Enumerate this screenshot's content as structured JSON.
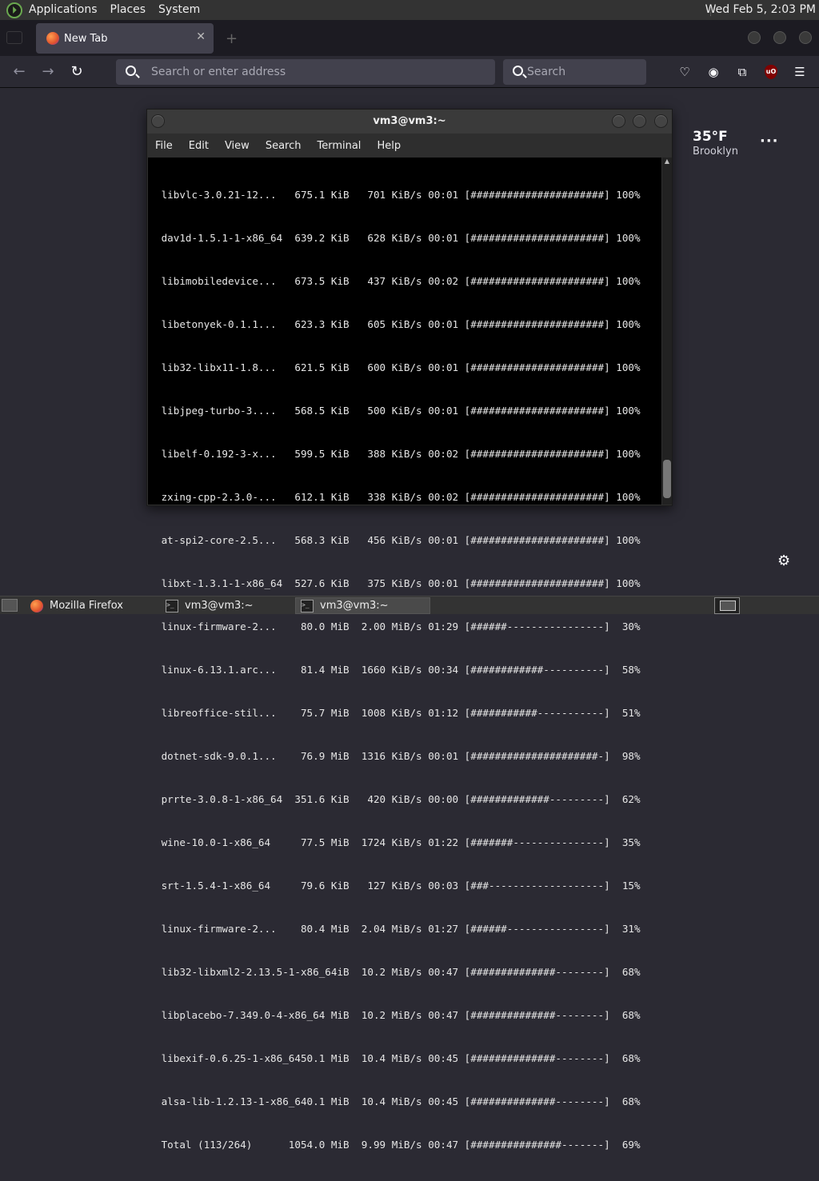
{
  "system_panel": {
    "menus": [
      "Applications",
      "Places",
      "System"
    ],
    "clock": "Wed Feb  5,  2:03 PM"
  },
  "browser": {
    "tab_title": "New Tab",
    "address_placeholder": "Search or enter address",
    "search_placeholder": "Search",
    "weather": {
      "temp": "35°F",
      "city": "Brooklyn"
    }
  },
  "terminal": {
    "title": "vm3@vm3:~",
    "menu": [
      "File",
      "Edit",
      "View",
      "Search",
      "Terminal",
      "Help"
    ],
    "lines": [
      " libvlc-3.0.21-12...   675.1 KiB   701 KiB/s 00:01 [######################] 100%",
      " dav1d-1.5.1-1-x86_64  639.2 KiB   628 KiB/s 00:01 [######################] 100%",
      " libimobiledevice...   673.5 KiB   437 KiB/s 00:02 [######################] 100%",
      " libetonyek-0.1.1...   623.3 KiB   605 KiB/s 00:01 [######################] 100%",
      " lib32-libx11-1.8...   621.5 KiB   600 KiB/s 00:01 [######################] 100%",
      " libjpeg-turbo-3....   568.5 KiB   500 KiB/s 00:01 [######################] 100%",
      " libelf-0.192-3-x...   599.5 KiB   388 KiB/s 00:02 [######################] 100%",
      " zxing-cpp-2.3.0-...   612.1 KiB   338 KiB/s 00:02 [######################] 100%",
      " at-spi2-core-2.5...   568.3 KiB   456 KiB/s 00:01 [######################] 100%",
      " libxt-1.3.1-1-x86_64  527.6 KiB   375 KiB/s 00:01 [######################] 100%",
      " linux-firmware-2...    80.0 MiB  2.00 MiB/s 01:29 [######----------------]  30%",
      " linux-6.13.1.arc...    81.4 MiB  1660 KiB/s 00:34 [############----------]  58%",
      " libreoffice-stil...    75.7 MiB  1008 KiB/s 01:12 [###########-----------]  51%",
      " dotnet-sdk-9.0.1...    76.9 MiB  1316 KiB/s 00:01 [#####################-]  98%",
      " prrte-3.0.8-1-x86_64  351.6 KiB   420 KiB/s 00:00 [#############---------]  62%",
      " wine-10.0-1-x86_64     77.5 MiB  1724 KiB/s 01:22 [#######---------------]  35%",
      " srt-1.5.4-1-x86_64     79.6 KiB   127 KiB/s 00:03 [###-------------------]  15%",
      " linux-firmware-2...    80.4 MiB  2.04 MiB/s 01:27 [######----------------]  31%",
      " lib32-libxml2-2.13.5-1-x86_64iB  10.2 MiB/s 00:47 [##############--------]  68%",
      " libplacebo-7.349.0-4-x86_64 MiB  10.2 MiB/s 00:47 [##############--------]  68%",
      " libexif-0.6.25-1-x86_6450.1 MiB  10.4 MiB/s 00:45 [##############--------]  68%",
      " alsa-lib-1.2.13-1-x86_640.1 MiB  10.4 MiB/s 00:45 [##############--------]  68%",
      " Total (113/264)      1054.0 MiB  9.99 MiB/s 00:47 [###############-------]  69%"
    ]
  },
  "taskbar": {
    "tasks": [
      {
        "label": "Mozilla Firefox"
      },
      {
        "label": "vm3@vm3:~"
      },
      {
        "label": "vm3@vm3:~"
      }
    ]
  },
  "colors": {
    "panel": "#333333",
    "browser_bg": "#2b2a33",
    "urlbar": "#42414d",
    "terminal_bg": "#000000"
  },
  "icons": [
    "distro-icon",
    "back-icon",
    "forward-icon",
    "reload-icon",
    "search-icon",
    "pocket-icon",
    "account-icon",
    "extensions-icon",
    "ublock-icon",
    "menu-icon",
    "gear-icon",
    "firefox-icon",
    "terminal-icon"
  ]
}
